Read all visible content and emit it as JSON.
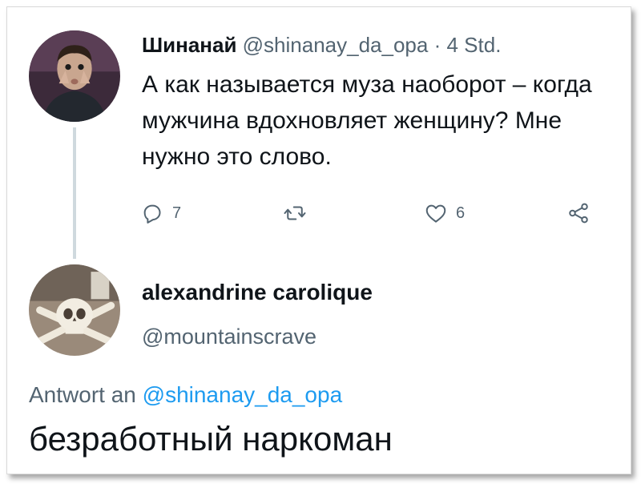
{
  "tweet1": {
    "author_name": "Шинанай",
    "handle": "@shinanay_da_opa",
    "separator": "·",
    "time": "4 Std.",
    "text": "А как называется муза наоборот – когда мужчина вдохновляет женщину? Мне нужно это слово.",
    "actions": {
      "reply_icon": "reply-icon",
      "reply_count": "7",
      "retweet_icon": "retweet-icon",
      "like_icon": "heart-icon",
      "like_count": "6",
      "share_icon": "share-icon"
    }
  },
  "tweet2": {
    "author_name": "alexandrine carolique",
    "handle": "@mountainscrave",
    "reply_to_label": "Antwort an",
    "reply_to_handle": "@shinanay_da_opa",
    "text": "безработный наркоман"
  },
  "colors": {
    "text_primary": "#0f1419",
    "text_secondary": "#536471",
    "link": "#1d9bf0",
    "thread_line": "#cfd9de"
  }
}
